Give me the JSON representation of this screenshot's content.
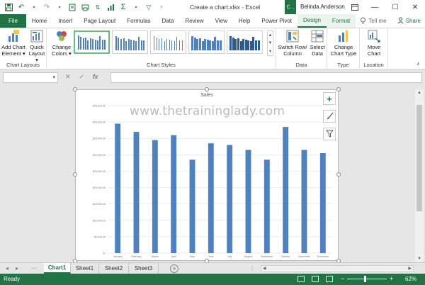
{
  "app": {
    "document_title": "Create a chart.xlsx - Excel",
    "context_badge": "C...",
    "user": "Belinda Anderson"
  },
  "tabs": [
    "File",
    "Home",
    "Insert",
    "Page Layout",
    "Formulas",
    "Data",
    "Review",
    "View",
    "Help",
    "Power Pivot",
    "Design",
    "Format"
  ],
  "tell_me": "Tell me",
  "share": "Share",
  "ribbon": {
    "chart_layouts": {
      "label": "Chart Layouts",
      "add_chart_element": [
        "Add Chart",
        "Element"
      ],
      "quick_layout": [
        "Quick",
        "Layout"
      ]
    },
    "chart_styles": {
      "label": "Chart Styles",
      "change_colors": [
        "Change",
        "Colors"
      ]
    },
    "data": {
      "label": "Data",
      "switch_row_column": [
        "Switch Row/",
        "Column"
      ],
      "select_data": [
        "Select",
        "Data"
      ]
    },
    "type": {
      "label": "Type",
      "change_chart_type": [
        "Change",
        "Chart Type"
      ]
    },
    "location": {
      "label": "Location",
      "move_chart": [
        "Move",
        "Chart"
      ]
    }
  },
  "formula_bar": {
    "name_box": "",
    "formula": "",
    "fx": "fx"
  },
  "watermark": "www.thetraininglady.com",
  "chart_data": {
    "type": "bar",
    "title": "Sales",
    "categories": [
      "January",
      "February",
      "March",
      "April",
      "May",
      "June",
      "July",
      "August",
      "September",
      "October",
      "November",
      "December"
    ],
    "values": [
      39500,
      37000,
      34500,
      36000,
      28500,
      33500,
      33000,
      31500,
      28500,
      38500,
      31500,
      30500
    ],
    "ylim": [
      0,
      45000
    ],
    "yticks": [
      "$45,000.00",
      "$40,000.00",
      "$35,000.00",
      "$30,000.00",
      "$25,000.00",
      "$20,000.00",
      "$15,000.00",
      "$10,000.00",
      "$5,000.00",
      "$-"
    ],
    "bar_color": "#4f81bd",
    "grid": true
  },
  "sheets": [
    "Chart1",
    "Sheet1",
    "Sheet2",
    "Sheet3"
  ],
  "status": {
    "ready": "Ready",
    "zoom": "62%"
  },
  "colors": {
    "excel_green": "#217346",
    "bar": "#4f81bd"
  }
}
